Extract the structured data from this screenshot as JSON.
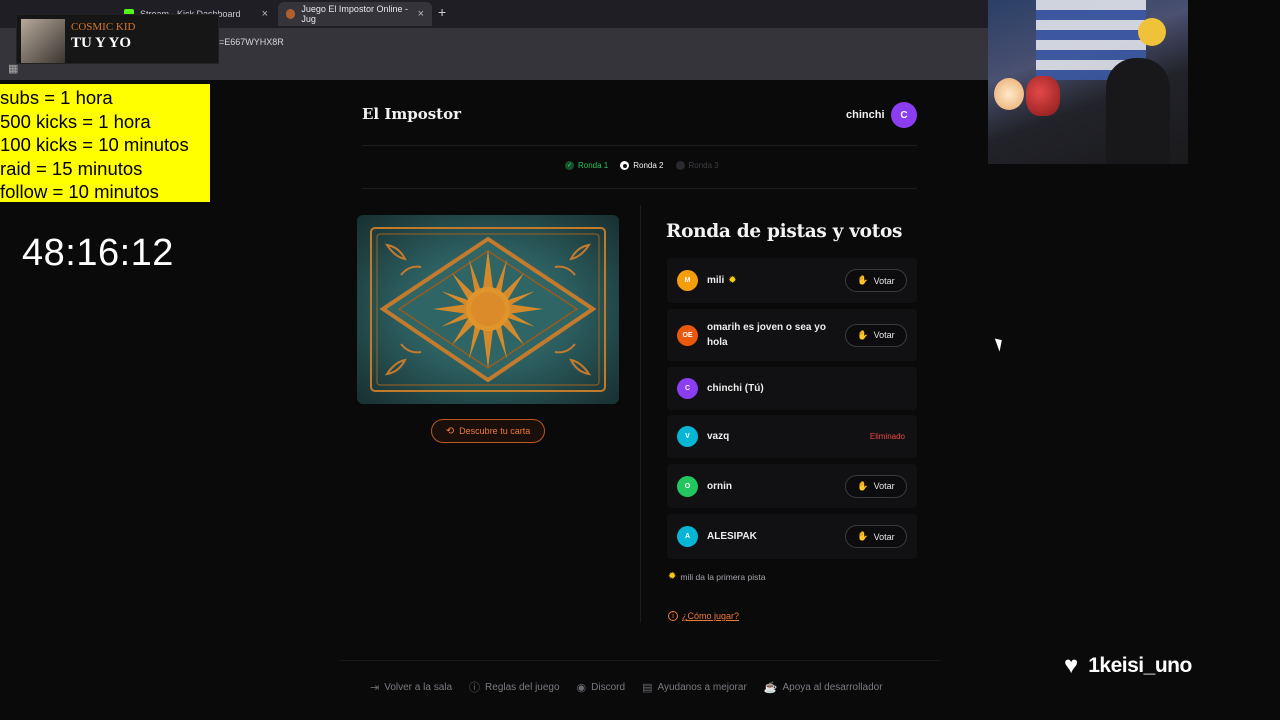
{
  "browser": {
    "tabs": [
      {
        "label": "Stream - Kick Dashboard",
        "active": false
      },
      {
        "label": "Juego El Impostor Online - Jug",
        "active": true
      }
    ],
    "new_tab_icon": "plus-icon",
    "address_fragment": "=E667WYHX8R"
  },
  "overlay": {
    "music": {
      "artist": "COSMIC KID",
      "song": "TU Y YO"
    },
    "subathon_rules": [
      "subs = 1 hora",
      "500 kicks = 1 hora",
      "100 kicks = 10 minutos",
      "raid = 15 minutos",
      "follow = 10 minutos"
    ],
    "timer": "48:16:12",
    "follower_name": "1keisi_uno",
    "follower_icon": "heart-icon"
  },
  "app": {
    "brand": "El Impostor",
    "user": {
      "name": "chinchi",
      "initial": "C",
      "color": "#8b3df2"
    },
    "rounds": [
      {
        "label": "Ronda 1",
        "state": "done"
      },
      {
        "label": "Ronda 2",
        "state": "current"
      },
      {
        "label": "Ronda 3",
        "state": "pending"
      }
    ],
    "reveal_button": "Descubre tu carta",
    "round_title": "Ronda de pistas y votos",
    "players": [
      {
        "initials": "M",
        "name": "mili",
        "color": "#f59e0b",
        "first_hint": true,
        "action": "vote"
      },
      {
        "initials": "OE",
        "name": "omarih es joven o sea yo hola",
        "color": "#ea580c",
        "first_hint": false,
        "action": "vote"
      },
      {
        "initials": "C",
        "name": "chinchi (Tú)",
        "color": "#8b3df2",
        "first_hint": false,
        "action": "none"
      },
      {
        "initials": "V",
        "name": "vazq",
        "color": "#06b6d4",
        "first_hint": false,
        "action": "eliminated"
      },
      {
        "initials": "O",
        "name": "ornin",
        "color": "#22c55e",
        "first_hint": false,
        "action": "vote"
      },
      {
        "initials": "A",
        "name": "ALESIPAK",
        "color": "#06b6d4",
        "first_hint": false,
        "action": "vote"
      }
    ],
    "vote_label": "Votar",
    "eliminated_label": "Eliminado",
    "hint_text": "mili da la primera pista",
    "howto_label": "¿Cómo jugar?",
    "footer": [
      {
        "label": "Volver a la sala",
        "icon": "exit-icon"
      },
      {
        "label": "Reglas del juego",
        "icon": "info-icon"
      },
      {
        "label": "Discord",
        "icon": "discord-icon"
      },
      {
        "label": "Ayudanos a mejorar",
        "icon": "chat-icon"
      },
      {
        "label": "Apoya al desarrollador",
        "icon": "coffee-icon"
      }
    ]
  }
}
